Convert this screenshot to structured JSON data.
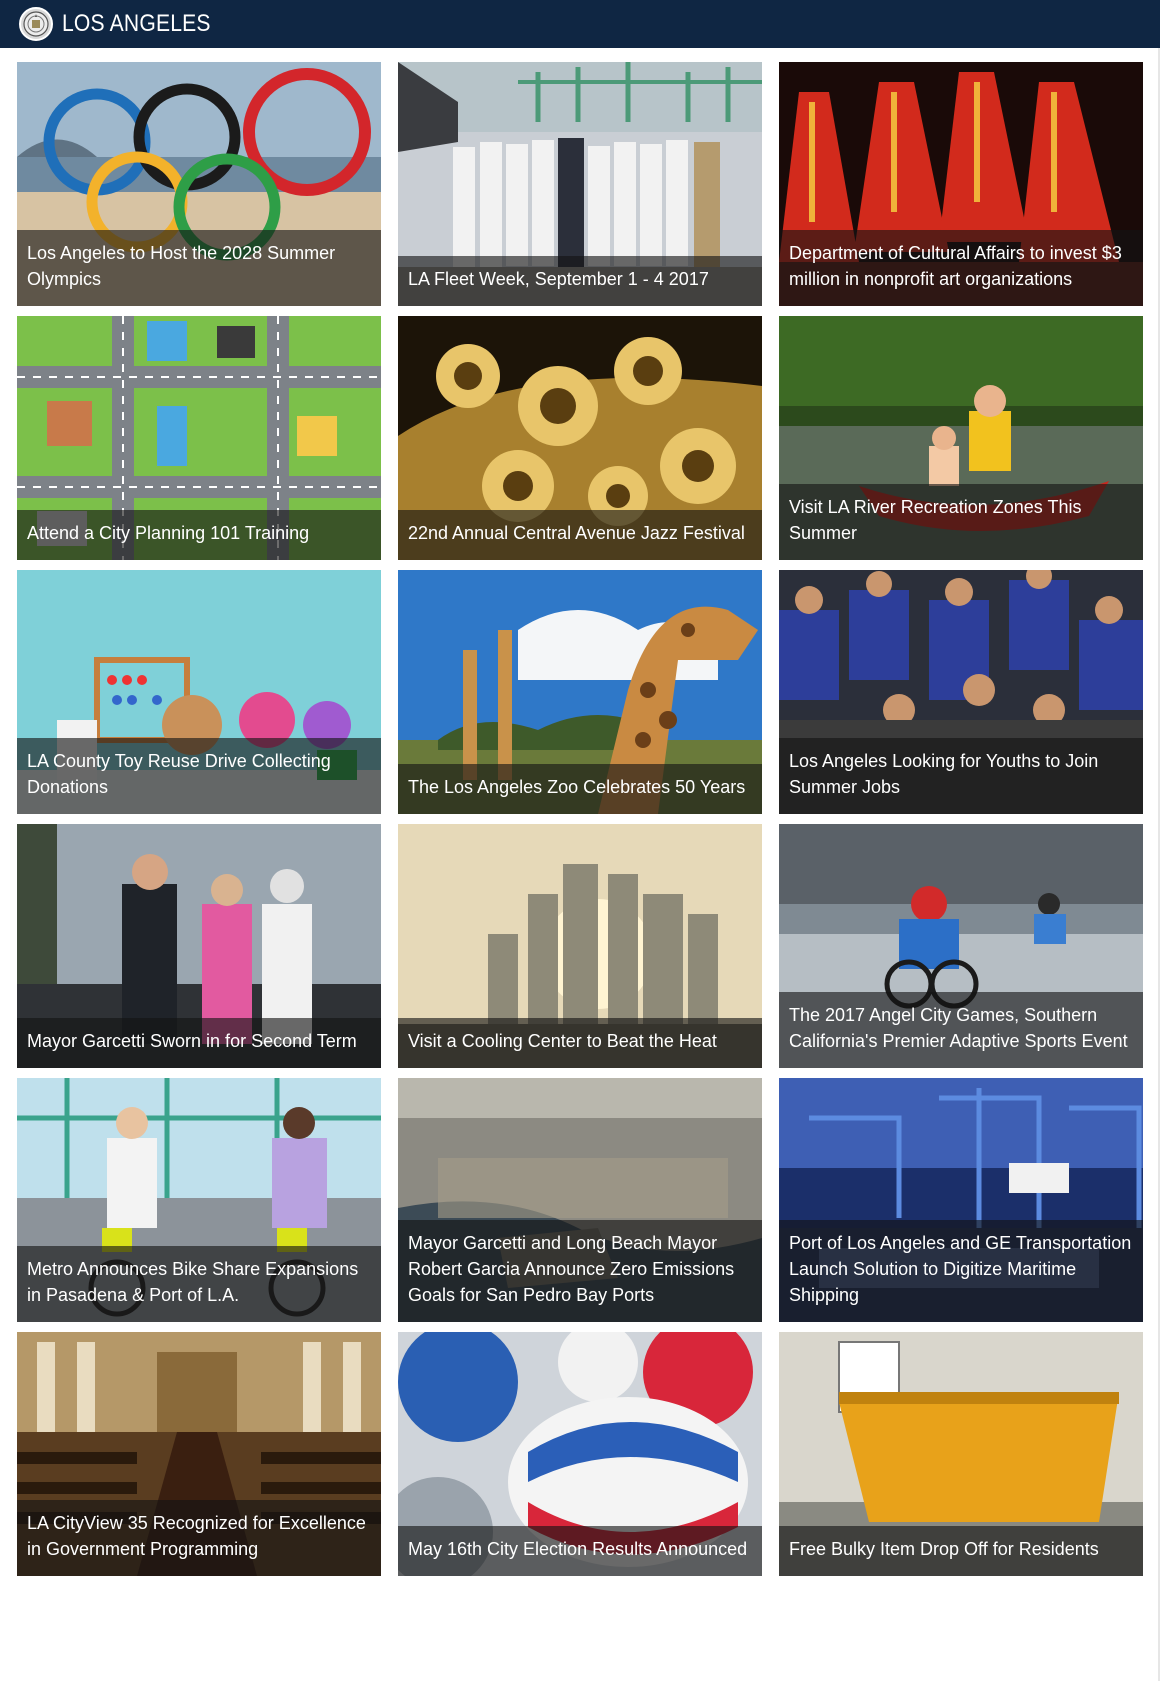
{
  "header": {
    "title": "LOS ANGELES",
    "logo_icon": "city-seal-icon",
    "background": "#0f2643"
  },
  "tiles": [
    {
      "id": "olympics",
      "caption": "Los Angeles to Host the 2028 Summer Olympics"
    },
    {
      "id": "fleet-week",
      "caption": "LA Fleet Week, September 1 - 4 2017"
    },
    {
      "id": "cultural",
      "caption": "Department of Cultural Affairs to invest $3 million in nonprofit art organizations"
    },
    {
      "id": "planning",
      "caption": "Attend a City Planning 101 Training"
    },
    {
      "id": "jazz",
      "caption": "22nd Annual Central Avenue Jazz Festival"
    },
    {
      "id": "river",
      "caption": "Visit LA River Recreation Zones This Summer"
    },
    {
      "id": "toys",
      "caption": "LA County Toy Reuse Drive Collecting Donations"
    },
    {
      "id": "zoo",
      "caption": "The Los Angeles Zoo Celebrates 50 Years"
    },
    {
      "id": "youth-jobs",
      "caption": "Los Angeles Looking for Youths to Join Summer Jobs"
    },
    {
      "id": "sworn-in",
      "caption": "Mayor Garcetti Sworn in for Second Term"
    },
    {
      "id": "cooling",
      "caption": "Visit a Cooling Center to Beat the Heat"
    },
    {
      "id": "angel-games",
      "caption": "The 2017 Angel City Games, Southern California's Premier Adaptive Sports Event"
    },
    {
      "id": "bike-share",
      "caption": "Metro Announces Bike Share Expansions in Pasadena & Port of L.A."
    },
    {
      "id": "ports",
      "caption": "Mayor Garcetti and Long Beach Mayor Robert Garcia Announce Zero Emissions Goals for San Pedro Bay Ports"
    },
    {
      "id": "ge",
      "caption": "Port of Los Angeles and GE Transportation Launch Solution to Digitize Maritime Shipping"
    },
    {
      "id": "cityview",
      "caption": "LA CityView 35 Recognized for Excellence in Government Programming"
    },
    {
      "id": "election",
      "caption": "May 16th City Election Results Announced"
    },
    {
      "id": "bulky",
      "caption": "Free Bulky Item Drop Off for Residents"
    }
  ]
}
